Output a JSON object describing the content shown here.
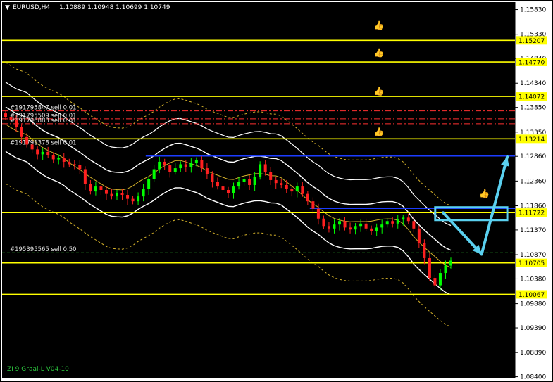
{
  "header": {
    "symbol": "EURUSD,H4",
    "ohlc": "1.10889 1.10948 1.10699 1.10749"
  },
  "indicator_label": "ZI 9 Graal-L V04-10",
  "colors": {
    "background": "#000000",
    "level_line": "#ffff00",
    "price_tag_bg": "#ffff00",
    "bollinger": "#ffffff",
    "ma_dashed": "#d4b12a",
    "blue_line": "#1b3cff",
    "arrow": "#5ad0ef",
    "bull_candle": "#00ff00",
    "bear_candle": "#ff2020",
    "order_line": "#ff3030",
    "pending_line": "#2a9b2a",
    "axis_bg": "#ffffff"
  },
  "chart_data": {
    "type": "candlestick",
    "symbol": "EURUSD",
    "timeframe": "H4",
    "y_axis": {
      "ylim": [
        1.0838,
        1.1598
      ],
      "ticks": [
        "1.15830",
        "1.15330",
        "1.14840",
        "1.14340",
        "1.13850",
        "1.13350",
        "1.12860",
        "1.12360",
        "1.11860",
        "1.11370",
        "1.10870",
        "1.10380",
        "1.09880",
        "1.09390",
        "1.08890",
        "1.08400"
      ]
    },
    "horizontal_levels": [
      1.15207,
      1.1477,
      1.14072,
      1.13214,
      1.11722,
      1.10705,
      1.10067
    ],
    "level_labels": [
      "1.15207",
      "1.14770",
      "1.14072",
      "1.13214",
      "1.11722",
      "1.10705",
      "1.10067"
    ],
    "blue_levels": [
      {
        "from_bar": 0.28,
        "price": 1.1287
      },
      {
        "from_bar": 0.6,
        "price": 1.1181
      }
    ],
    "orders": [
      {
        "label": "#191795847 sell 0.01",
        "price": 1.1378
      },
      {
        "label": "#191795509 sell 0.01",
        "price": 1.1362
      },
      {
        "label": "#191796888 sell 0.01",
        "price": 1.1352
      },
      {
        "label": "#191791378 sell 0.01",
        "price": 1.1307
      },
      {
        "label": "#195395565 sell 0.50",
        "price": 1.1091
      }
    ],
    "close_path": [
      1.1365,
      1.136,
      1.1345,
      1.1325,
      1.131,
      1.13,
      1.129,
      1.1295,
      1.1288,
      1.128,
      1.1282,
      1.1275,
      1.127,
      1.1268,
      1.126,
      1.123,
      1.1215,
      1.1225,
      1.1218,
      1.121,
      1.1205,
      1.1212,
      1.1208,
      1.12,
      1.1195,
      1.1205,
      1.122,
      1.124,
      1.126,
      1.1275,
      1.1268,
      1.1255,
      1.1262,
      1.127,
      1.1265,
      1.1272,
      1.1278,
      1.1262,
      1.125,
      1.1235,
      1.1225,
      1.1218,
      1.1212,
      1.1225,
      1.1235,
      1.124,
      1.1228,
      1.1245,
      1.127,
      1.1255,
      1.1238,
      1.1232,
      1.1228,
      1.122,
      1.1215,
      1.1225,
      1.121,
      1.1195,
      1.118,
      1.116,
      1.1145,
      1.114,
      1.1148,
      1.1155,
      1.1142,
      1.1138,
      1.1145,
      1.115,
      1.114,
      1.1135,
      1.1142,
      1.1148,
      1.1155,
      1.115,
      1.1158,
      1.1162,
      1.1155,
      1.114,
      1.111,
      1.108,
      1.104,
      1.1025,
      1.105,
      1.1065,
      1.1075
    ],
    "arrows": [
      {
        "from": [
          0.86,
          1.1172
        ],
        "to": [
          0.935,
          1.1088
        ],
        "label": "down"
      },
      {
        "from": [
          0.935,
          1.1088
        ],
        "to": [
          0.985,
          1.1285
        ],
        "label": "up"
      }
    ],
    "target_box": {
      "price_top": 1.118,
      "price_bottom": 1.116,
      "x0": 0.85,
      "x1": 0.985
    }
  }
}
